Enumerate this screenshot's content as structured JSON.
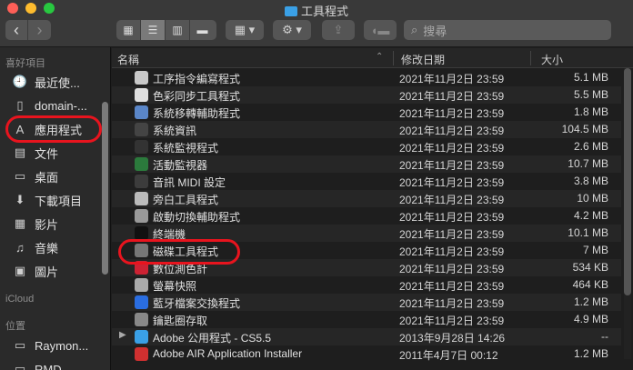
{
  "window": {
    "title": "工具程式"
  },
  "toolbar": {
    "search_placeholder": "搜尋",
    "view_options": [
      "grid",
      "list",
      "columns",
      "gallery"
    ],
    "back": "‹",
    "forward": "›"
  },
  "sidebar": {
    "favorites_header": "喜好項目",
    "favorites": [
      {
        "label": "最近使...",
        "icon": "recent-icon"
      },
      {
        "label": "domain-...",
        "icon": "document-icon"
      },
      {
        "label": "應用程式",
        "icon": "applications-icon"
      },
      {
        "label": "文件",
        "icon": "document-icon"
      },
      {
        "label": "桌面",
        "icon": "desktop-icon"
      },
      {
        "label": "下載項目",
        "icon": "download-icon"
      },
      {
        "label": "影片",
        "icon": "movie-icon"
      },
      {
        "label": "音樂",
        "icon": "music-icon"
      },
      {
        "label": "圖片",
        "icon": "photo-icon"
      }
    ],
    "icloud_header": "iCloud",
    "locations_header": "位置",
    "locations": [
      {
        "label": "Raymon..."
      },
      {
        "label": "RMD..."
      }
    ]
  },
  "columns": {
    "name": "名稱",
    "date": "修改日期",
    "size": "大小"
  },
  "files": [
    {
      "name": "工序指令編寫程式",
      "date": "2021年11月2日 23:59",
      "size": "5.1 MB",
      "color": "#c9c9c9"
    },
    {
      "name": "色彩同步工具程式",
      "date": "2021年11月2日 23:59",
      "size": "5.5 MB",
      "color": "#e0e0e0"
    },
    {
      "name": "系統移轉輔助程式",
      "date": "2021年11月2日 23:59",
      "size": "1.8 MB",
      "color": "#5a86c8"
    },
    {
      "name": "系統資訊",
      "date": "2021年11月2日 23:59",
      "size": "104.5 MB",
      "color": "#444444"
    },
    {
      "name": "系統監視程式",
      "date": "2021年11月2日 23:59",
      "size": "2.6 MB",
      "color": "#333333"
    },
    {
      "name": "活動監視器",
      "date": "2021年11月2日 23:59",
      "size": "10.7 MB",
      "color": "#2b7a3c"
    },
    {
      "name": "音訊 MIDI 設定",
      "date": "2021年11月2日 23:59",
      "size": "3.8 MB",
      "color": "#3c3c3c"
    },
    {
      "name": "旁白工具程式",
      "date": "2021年11月2日 23:59",
      "size": "10 MB",
      "color": "#bbbbbb"
    },
    {
      "name": "啟動切換輔助程式",
      "date": "2021年11月2日 23:59",
      "size": "4.2 MB",
      "color": "#999999"
    },
    {
      "name": "終端機",
      "date": "2021年11月2日 23:59",
      "size": "10.1 MB",
      "color": "#111111"
    },
    {
      "name": "磁碟工具程式",
      "date": "2021年11月2日 23:59",
      "size": "7 MB",
      "color": "#777777"
    },
    {
      "name": "數位測色計",
      "date": "2021年11月2日 23:59",
      "size": "534 KB",
      "color": "#cc2233"
    },
    {
      "name": "螢幕快照",
      "date": "2021年11月2日 23:59",
      "size": "464 KB",
      "color": "#aaaaaa"
    },
    {
      "name": "藍牙檔案交換程式",
      "date": "2021年11月2日 23:59",
      "size": "1.2 MB",
      "color": "#2a6de0"
    },
    {
      "name": "鑰匙圈存取",
      "date": "2021年11月2日 23:59",
      "size": "4.9 MB",
      "color": "#888888"
    },
    {
      "name": "Adobe 公用程式 - CS5.5",
      "date": "2013年9月28日 14:26",
      "size": "--",
      "color": "#3aa0e6",
      "folder": true
    },
    {
      "name": "Adobe AIR Application Installer",
      "date": "2011年4月7日 00:12",
      "size": "1.2 MB",
      "color": "#d03030"
    }
  ],
  "accent": "#e8141e"
}
